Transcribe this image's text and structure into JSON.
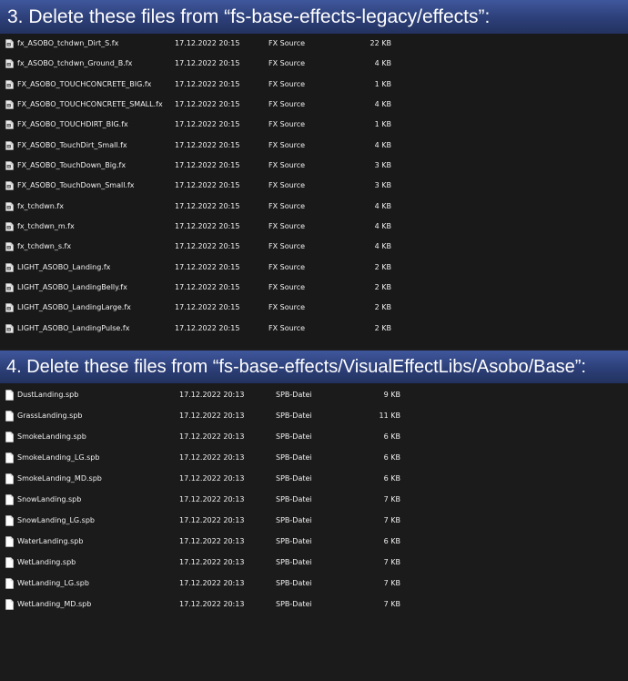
{
  "section1": {
    "heading": "3. Delete these files from “fs-base-effects-legacy/effects”:",
    "file_icon": "fx-file-icon",
    "files": [
      {
        "name": "fx_ASOBO_tchdwn_Dirt_S.fx",
        "date": "17.12.2022 20:15",
        "type": "FX Source",
        "size": "22 KB"
      },
      {
        "name": "fx_ASOBO_tchdwn_Ground_B.fx",
        "date": "17.12.2022 20:15",
        "type": "FX Source",
        "size": "4 KB"
      },
      {
        "name": "FX_ASOBO_TOUCHCONCRETE_BIG.fx",
        "date": "17.12.2022 20:15",
        "type": "FX Source",
        "size": "1 KB"
      },
      {
        "name": "FX_ASOBO_TOUCHCONCRETE_SMALL.fx",
        "date": "17.12.2022 20:15",
        "type": "FX Source",
        "size": "4 KB"
      },
      {
        "name": "FX_ASOBO_TOUCHDIRT_BIG.fx",
        "date": "17.12.2022 20:15",
        "type": "FX Source",
        "size": "1 KB"
      },
      {
        "name": "FX_ASOBO_TouchDirt_Small.fx",
        "date": "17.12.2022 20:15",
        "type": "FX Source",
        "size": "4 KB"
      },
      {
        "name": "FX_ASOBO_TouchDown_Big.fx",
        "date": "17.12.2022 20:15",
        "type": "FX Source",
        "size": "3 KB"
      },
      {
        "name": "FX_ASOBO_TouchDown_Small.fx",
        "date": "17.12.2022 20:15",
        "type": "FX Source",
        "size": "3 KB"
      },
      {
        "name": "fx_tchdwn.fx",
        "date": "17.12.2022 20:15",
        "type": "FX Source",
        "size": "4 KB"
      },
      {
        "name": "fx_tchdwn_m.fx",
        "date": "17.12.2022 20:15",
        "type": "FX Source",
        "size": "4 KB"
      },
      {
        "name": "fx_tchdwn_s.fx",
        "date": "17.12.2022 20:15",
        "type": "FX Source",
        "size": "4 KB"
      },
      {
        "name": "LIGHT_ASOBO_Landing.fx",
        "date": "17.12.2022 20:15",
        "type": "FX Source",
        "size": "2 KB"
      },
      {
        "name": "LIGHT_ASOBO_LandingBelly.fx",
        "date": "17.12.2022 20:15",
        "type": "FX Source",
        "size": "2 KB"
      },
      {
        "name": "LIGHT_ASOBO_LandingLarge.fx",
        "date": "17.12.2022 20:15",
        "type": "FX Source",
        "size": "2 KB"
      },
      {
        "name": "LIGHT_ASOBO_LandingPulse.fx",
        "date": "17.12.2022 20:15",
        "type": "FX Source",
        "size": "2 KB"
      }
    ]
  },
  "section2": {
    "heading": "4. Delete these files from “fs-base-effects/VisualEffectLibs/Asobo/Base”:",
    "file_icon": "blank-file-icon",
    "files": [
      {
        "name": "DustLanding.spb",
        "date": "17.12.2022 20:13",
        "type": "SPB-Datei",
        "size": "9 KB"
      },
      {
        "name": "GrassLanding.spb",
        "date": "17.12.2022 20:13",
        "type": "SPB-Datei",
        "size": "11 KB"
      },
      {
        "name": "SmokeLanding.spb",
        "date": "17.12.2022 20:13",
        "type": "SPB-Datei",
        "size": "6 KB"
      },
      {
        "name": "SmokeLanding_LG.spb",
        "date": "17.12.2022 20:13",
        "type": "SPB-Datei",
        "size": "6 KB"
      },
      {
        "name": "SmokeLanding_MD.spb",
        "date": "17.12.2022 20:13",
        "type": "SPB-Datei",
        "size": "6 KB"
      },
      {
        "name": "SnowLanding.spb",
        "date": "17.12.2022 20:13",
        "type": "SPB-Datei",
        "size": "7 KB"
      },
      {
        "name": "SnowLanding_LG.spb",
        "date": "17.12.2022 20:13",
        "type": "SPB-Datei",
        "size": "7 KB"
      },
      {
        "name": "WaterLanding.spb",
        "date": "17.12.2022 20:13",
        "type": "SPB-Datei",
        "size": "6 KB"
      },
      {
        "name": "WetLanding.spb",
        "date": "17.12.2022 20:13",
        "type": "SPB-Datei",
        "size": "7 KB"
      },
      {
        "name": "WetLanding_LG.spb",
        "date": "17.12.2022 20:13",
        "type": "SPB-Datei",
        "size": "7 KB"
      },
      {
        "name": "WetLanding_MD.spb",
        "date": "17.12.2022 20:13",
        "type": "SPB-Datei",
        "size": "7 KB"
      }
    ]
  }
}
